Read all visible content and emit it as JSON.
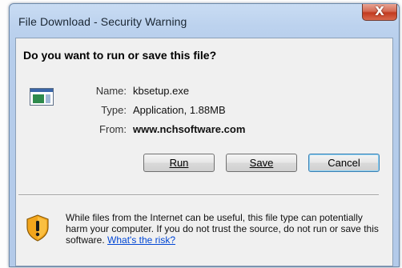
{
  "window": {
    "title": "File Download - Security Warning",
    "close_label": "X"
  },
  "dialog": {
    "question": "Do you want to run or save this file?",
    "file": {
      "name_label": "Name:",
      "name": "kbsetup.exe",
      "type_label": "Type:",
      "type": "Application, 1.88MB",
      "from_label": "From:",
      "from": "www.nchsoftware.com"
    },
    "buttons": {
      "run": "Run",
      "save": "Save",
      "cancel": "Cancel"
    },
    "warning": {
      "text": "While files from the Internet can be useful, this file type can potentially harm your computer. If you do not trust the source, do not run or save this software. ",
      "link": "What's the risk?"
    }
  },
  "colors": {
    "title_bar": "#bcd2ee",
    "close_button": "#c23a1f",
    "link": "#0046d5",
    "shield": "#f2a51c"
  },
  "icons": {
    "file": "application-window-icon",
    "warning": "shield-warning-icon"
  }
}
